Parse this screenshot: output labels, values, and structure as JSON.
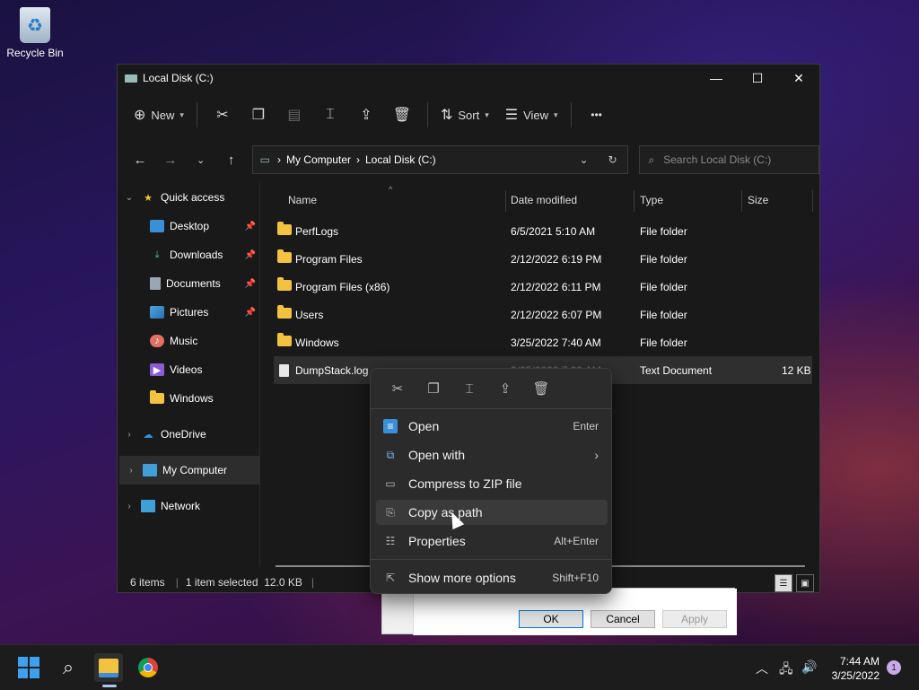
{
  "desktop": {
    "recycle_bin_label": "Recycle Bin"
  },
  "window": {
    "title": "Local Disk (C:)",
    "controls": {
      "minimize": "—",
      "maximize": "☐",
      "close": "✕"
    }
  },
  "toolbar": {
    "new_label": "New",
    "sort_label": "Sort",
    "view_label": "View",
    "more": "•••"
  },
  "navigation": {
    "breadcrumbs": [
      "My Computer",
      "Local Disk (C:)"
    ],
    "search_placeholder": "Search Local Disk (C:)"
  },
  "sidebar": {
    "quick_access": "Quick access",
    "items": [
      {
        "label": "Desktop",
        "pinned": true
      },
      {
        "label": "Downloads",
        "pinned": true
      },
      {
        "label": "Documents",
        "pinned": true
      },
      {
        "label": "Pictures",
        "pinned": true
      },
      {
        "label": "Music",
        "pinned": false
      },
      {
        "label": "Videos",
        "pinned": false
      },
      {
        "label": "Windows",
        "pinned": false
      }
    ],
    "onedrive": "OneDrive",
    "my_computer": "My Computer",
    "network": "Network"
  },
  "file_list": {
    "columns": [
      "Name",
      "Date modified",
      "Type",
      "Size"
    ],
    "rows": [
      {
        "name": "PerfLogs",
        "date": "6/5/2021 5:10 AM",
        "type": "File folder",
        "size": ""
      },
      {
        "name": "Program Files",
        "date": "2/12/2022 6:19 PM",
        "type": "File folder",
        "size": ""
      },
      {
        "name": "Program Files (x86)",
        "date": "2/12/2022 6:11 PM",
        "type": "File folder",
        "size": ""
      },
      {
        "name": "Users",
        "date": "2/12/2022 6:07 PM",
        "type": "File folder",
        "size": ""
      },
      {
        "name": "Windows",
        "date": "3/25/2022 7:40 AM",
        "type": "File folder",
        "size": ""
      },
      {
        "name": "DumpStack.log",
        "date": "3/25/2022 7:39 AM",
        "type": "Text Document",
        "size": "12 KB"
      }
    ]
  },
  "status": {
    "items": "6 items",
    "selected": "1 item selected  12.0 KB"
  },
  "context_menu": {
    "items": [
      {
        "label": "Open",
        "shortcut": "Enter"
      },
      {
        "label": "Open with",
        "shortcut": ""
      },
      {
        "label": "Compress to ZIP file",
        "shortcut": ""
      },
      {
        "label": "Copy as path",
        "shortcut": ""
      },
      {
        "label": "Properties",
        "shortcut": "Alt+Enter"
      },
      {
        "label": "Show more options",
        "shortcut": "Shift+F10"
      }
    ]
  },
  "dialog": {
    "ok": "OK",
    "cancel": "Cancel",
    "apply": "Apply"
  },
  "taskbar": {
    "time": "7:44 AM",
    "date": "3/25/2022",
    "notification_count": "1"
  }
}
